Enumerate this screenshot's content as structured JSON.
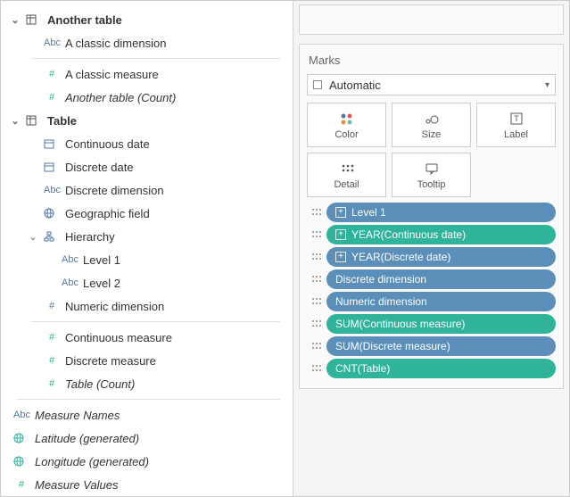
{
  "tables": [
    {
      "name": "Another table",
      "fields": [
        {
          "label": "A classic dimension",
          "icon": "Abc",
          "role": "dim",
          "italic": false
        },
        {
          "label": "A classic measure",
          "icon": "#",
          "role": "meas",
          "italic": false,
          "sepBefore": true
        },
        {
          "label": "Another table (Count)",
          "icon": "#",
          "role": "meas",
          "italic": true
        }
      ]
    },
    {
      "name": "Table",
      "fields": [
        {
          "label": "Continuous date",
          "icon": "date",
          "role": "dim"
        },
        {
          "label": "Discrete date",
          "icon": "date",
          "role": "dim"
        },
        {
          "label": "Discrete dimension",
          "icon": "Abc",
          "role": "dim"
        },
        {
          "label": "Geographic field",
          "icon": "globe",
          "role": "dim"
        },
        {
          "label": "Hierarchy",
          "icon": "hier",
          "role": "dim",
          "expandable": true,
          "children": [
            {
              "label": "Level 1",
              "icon": "Abc",
              "role": "dim"
            },
            {
              "label": "Level 2",
              "icon": "Abc",
              "role": "dim"
            }
          ]
        },
        {
          "label": "Numeric dimension",
          "icon": "#",
          "role": "dim"
        },
        {
          "label": "Continuous measure",
          "icon": "#",
          "role": "meas",
          "sepBefore": true
        },
        {
          "label": "Discrete measure",
          "icon": "#",
          "role": "meas"
        },
        {
          "label": "Table (Count)",
          "icon": "#",
          "role": "meas",
          "italic": true
        }
      ]
    }
  ],
  "generated": [
    {
      "label": "Measure Names",
      "icon": "Abc",
      "role": "dim",
      "italic": true
    },
    {
      "label": "Latitude (generated)",
      "icon": "globe",
      "role": "meas",
      "italic": true
    },
    {
      "label": "Longitude (generated)",
      "icon": "globe",
      "role": "meas",
      "italic": true
    },
    {
      "label": "Measure Values",
      "icon": "#",
      "role": "meas",
      "italic": true
    }
  ],
  "marks": {
    "title": "Marks",
    "type": "Automatic",
    "shelves": [
      {
        "key": "color",
        "label": "Color"
      },
      {
        "key": "size",
        "label": "Size"
      },
      {
        "key": "label",
        "label": "Label"
      },
      {
        "key": "detail",
        "label": "Detail"
      },
      {
        "key": "tooltip",
        "label": "Tooltip"
      }
    ],
    "pills": [
      {
        "text": "Level 1",
        "color": "blue",
        "expand": true
      },
      {
        "text": "YEAR(Continuous date)",
        "color": "green",
        "expand": true
      },
      {
        "text": "YEAR(Discrete date)",
        "color": "blue",
        "expand": true
      },
      {
        "text": "Discrete dimension",
        "color": "blue",
        "expand": false
      },
      {
        "text": "Numeric dimension",
        "color": "blue",
        "expand": false
      },
      {
        "text": "SUM(Continuous measure)",
        "color": "green",
        "expand": false
      },
      {
        "text": "SUM(Discrete measure)",
        "color": "blue",
        "expand": false
      },
      {
        "text": "CNT(Table)",
        "color": "green",
        "expand": false
      }
    ]
  }
}
